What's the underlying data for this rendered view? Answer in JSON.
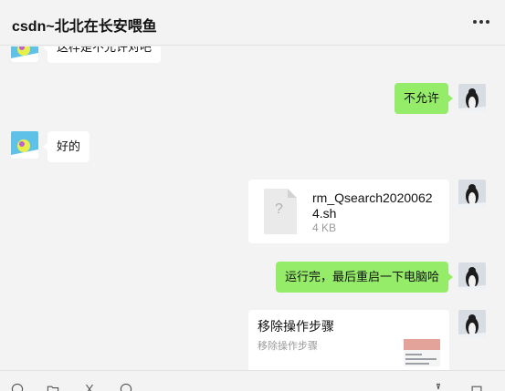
{
  "header": {
    "title": "csdn~北北在长安喂鱼",
    "more_icon": "more-horizontal-icon"
  },
  "messages": [
    {
      "side": "in",
      "text": "这样是不允许对吧"
    },
    {
      "side": "out",
      "text": "不允许"
    },
    {
      "side": "in",
      "text": "好的"
    },
    {
      "side": "out",
      "type": "file",
      "file_name": "rm_Qsearch20200624.sh",
      "file_size": "4 KB",
      "file_icon_glyph": "?"
    },
    {
      "side": "out",
      "text": "运行完，最后重启一下电脑哈"
    },
    {
      "side": "out",
      "type": "link",
      "title": "移除操作步骤",
      "description": "移除操作步骤"
    }
  ],
  "toolbar": {
    "icons": [
      "emoji-icon",
      "folder-icon",
      "scissors-icon",
      "chat-bubble-icon",
      "phone-icon",
      "video-call-icon"
    ]
  },
  "colors": {
    "outgoing_bubble": "#95ec69",
    "incoming_bubble": "#ffffff",
    "background": "#f3f3f3"
  }
}
